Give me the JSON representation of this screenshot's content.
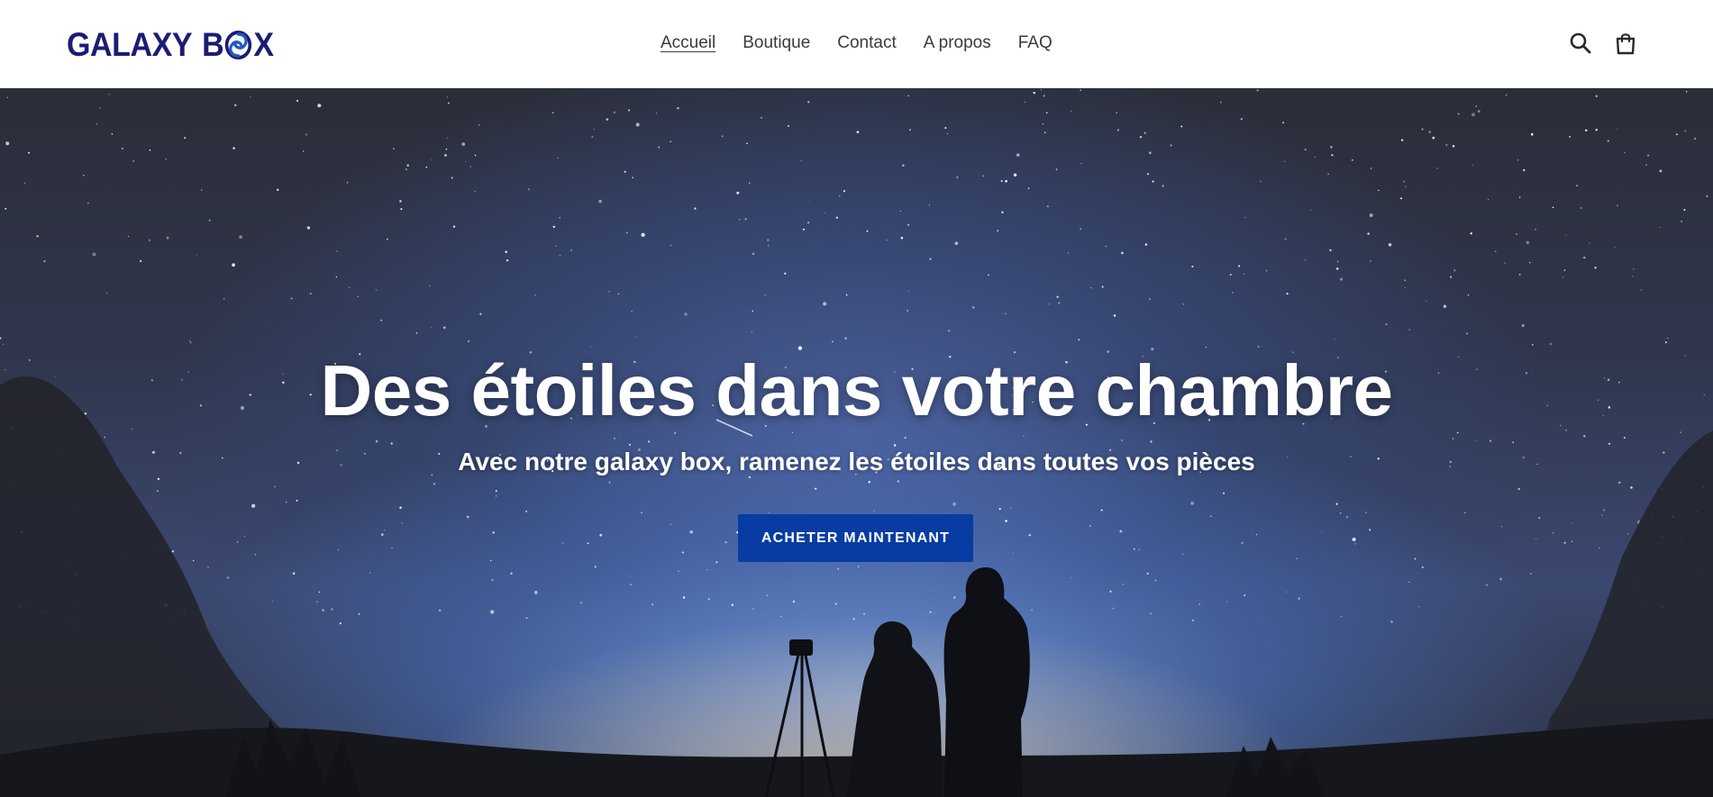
{
  "header": {
    "logo": {
      "part1": "GALAXY",
      "part2": "B",
      "part3": "X"
    },
    "nav": [
      {
        "label": "Accueil",
        "active": true
      },
      {
        "label": "Boutique"
      },
      {
        "label": "Contact"
      },
      {
        "label": "A propos"
      },
      {
        "label": "FAQ"
      }
    ],
    "icons": {
      "search": "search-icon",
      "cart": "cart-icon"
    }
  },
  "hero": {
    "title": "Des étoiles dans votre chambre",
    "subtitle": "Avec notre galaxy box, ramenez les étoiles dans toutes vos pièces",
    "cta": "ACHETER MAINTENANT"
  },
  "colors": {
    "brand": "#1c1c73",
    "cta": "#073ca3",
    "nav_text": "#3a3a3a"
  }
}
